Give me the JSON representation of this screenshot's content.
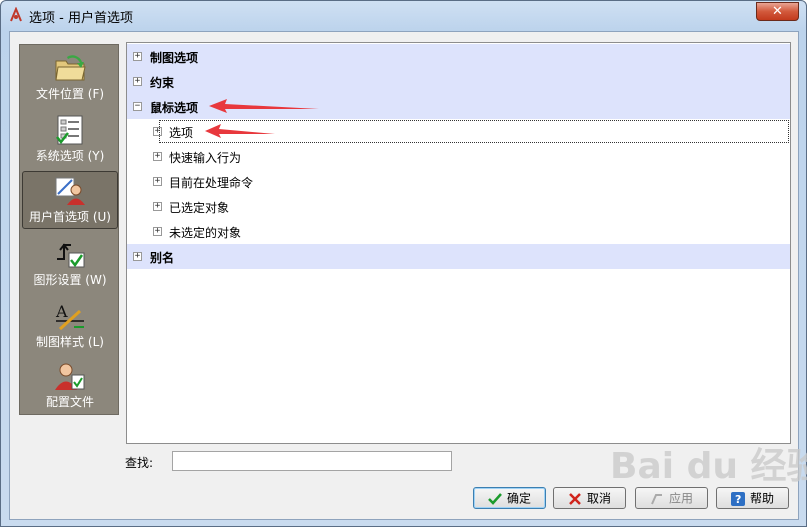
{
  "window": {
    "title": "选项 - 用户首选项",
    "close_glyph": "✕"
  },
  "sidebar": {
    "items": [
      {
        "label": "文件位置",
        "mnemonic": "(F)",
        "icon": "folder-icon"
      },
      {
        "label": "系统选项",
        "mnemonic": "(Y)",
        "icon": "checklist-icon"
      },
      {
        "label": "用户首选项",
        "mnemonic": "(U)",
        "icon": "user-tools-icon",
        "selected": true
      },
      {
        "label": "图形设置",
        "mnemonic": "(W)",
        "icon": "graphics-settings-icon"
      },
      {
        "label": "制图样式",
        "mnemonic": "(L)",
        "icon": "drafting-style-icon"
      },
      {
        "label": "配置文件",
        "mnemonic": "",
        "icon": "profile-icon"
      }
    ]
  },
  "tree": {
    "nodes": [
      {
        "label": "制图选项",
        "level": 0,
        "expanded": false
      },
      {
        "label": "约束",
        "level": 0,
        "expanded": false
      },
      {
        "label": "鼠标选项",
        "level": 0,
        "expanded": true
      },
      {
        "label": "选项",
        "level": 1,
        "expanded": false,
        "focused": true
      },
      {
        "label": "快速输入行为",
        "level": 1,
        "expanded": false
      },
      {
        "label": "目前在处理命令",
        "level": 1,
        "expanded": false
      },
      {
        "label": "已选定对象",
        "level": 1,
        "expanded": false
      },
      {
        "label": "未选定的对象",
        "level": 1,
        "expanded": false
      },
      {
        "label": "别名",
        "level": 0,
        "expanded": false
      }
    ],
    "expand_glyph": "+",
    "collapse_glyph": "−"
  },
  "search": {
    "label": "查找:",
    "value": ""
  },
  "buttons": {
    "ok": "确定",
    "cancel": "取消",
    "apply": "应用",
    "help": "帮助"
  },
  "watermark": "Bai du 经验",
  "colors": {
    "group_row": "#dde3fc",
    "sidebar": "#8c877c",
    "arrow": "#e8383d"
  }
}
